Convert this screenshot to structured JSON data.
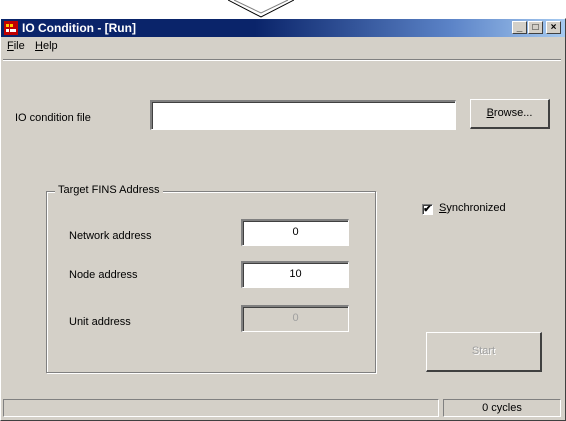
{
  "window": {
    "title": "IO Condition - [Run]",
    "controls": {
      "minimize": "_",
      "maximize": "□",
      "close": "×"
    }
  },
  "menu": [
    {
      "label": "File",
      "mnemonic": "F",
      "rest": "ile"
    },
    {
      "label": "Help",
      "mnemonic": "H",
      "rest": "elp"
    }
  ],
  "file": {
    "label": "IO condition file",
    "value": "",
    "browse": {
      "mnemonic": "B",
      "rest": "rowse..."
    }
  },
  "target": {
    "group_title": "Target FINS Address",
    "network": {
      "label": "Network address",
      "value": "0"
    },
    "node": {
      "label": "Node address",
      "value": "10"
    },
    "unit": {
      "label": "Unit address",
      "value": "0",
      "disabled": true
    }
  },
  "synchronized": {
    "checked": true,
    "mnemonic": "S",
    "rest": "ynchronized"
  },
  "start_button": {
    "label": "Start",
    "disabled": true
  },
  "status": {
    "left": "",
    "right": "0 cycles"
  },
  "colors": {
    "face": "#d4d0c8",
    "title_active": "#0a246a",
    "title_gradient_end": "#a6caf0"
  },
  "icons": [
    "app-icon",
    "minimize-icon",
    "maximize-icon",
    "close-icon",
    "check-icon"
  ]
}
